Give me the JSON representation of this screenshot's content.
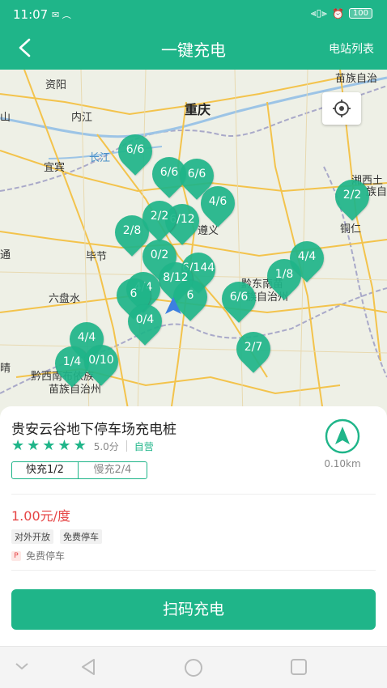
{
  "status": {
    "time": "11:07",
    "left_icons": "✉ ︵",
    "battery": "100"
  },
  "header": {
    "title": "一键充电",
    "right_link": "电站列表"
  },
  "map": {
    "cities": [
      {
        "name": "重庆",
        "big": true
      },
      {
        "name": "资阳"
      },
      {
        "name": "内江"
      },
      {
        "name": "山"
      },
      {
        "name": "宜宾"
      },
      {
        "name": "长江",
        "water": true
      },
      {
        "name": "遵义"
      },
      {
        "name": "毕节"
      },
      {
        "name": "六盘水"
      },
      {
        "name": "黔东南苗"
      },
      {
        "name": "族自治州"
      },
      {
        "name": "铜仁"
      },
      {
        "name": "湘西土"
      },
      {
        "name": "族自"
      },
      {
        "name": "黔西南布依族"
      },
      {
        "name": "苗族自治州"
      },
      {
        "name": "苗族自治"
      },
      {
        "name": "晴"
      },
      {
        "name": "通"
      }
    ],
    "pins": [
      "6/6",
      "6/6",
      "6/6",
      "4/6",
      "2/2",
      "6/12",
      "2/8",
      "2/2",
      "0/2",
      "1/8",
      "4/4",
      "6/144",
      "8/12",
      "4/4",
      "6",
      "6",
      "6/6",
      "0/4",
      "4/4",
      "1/4",
      "0/10",
      "2/7"
    ]
  },
  "station": {
    "name": "贵安云谷地下停车场充电桩",
    "rating_stars": 5,
    "score": "5.0分",
    "self_run": "自营",
    "fast": "快充1/2",
    "slow": "慢充2/4",
    "distance": "0.10km",
    "price": "1.00元/度",
    "tags": [
      "对外开放",
      "免费停车"
    ],
    "parking_icon": "P",
    "parking": "免费停车"
  },
  "action": {
    "scan_label": "扫码充电"
  },
  "colors": {
    "brand": "#1fb589",
    "price": "#e64545"
  },
  "icons": [
    "back-arrow-icon",
    "locate-icon",
    "navigate-icon",
    "nav-back-icon",
    "nav-home-icon",
    "nav-recent-icon",
    "nav-down-icon"
  ]
}
